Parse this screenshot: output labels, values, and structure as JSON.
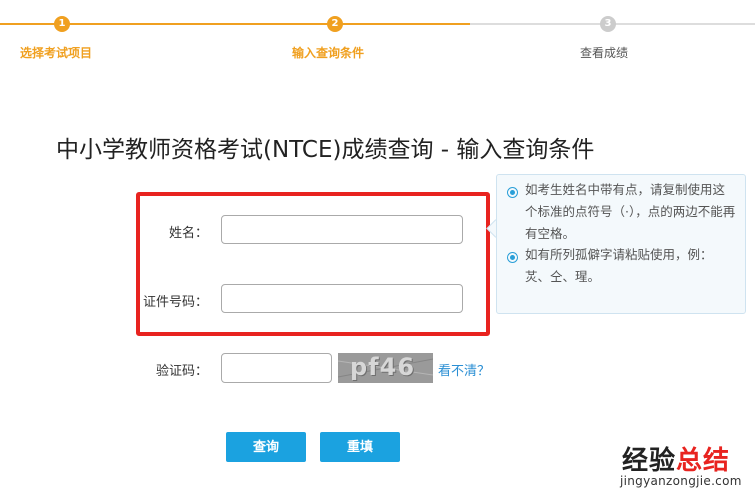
{
  "steps": [
    {
      "number": "1",
      "label": "选择考试项目"
    },
    {
      "number": "2",
      "label": "输入查询条件"
    },
    {
      "number": "3",
      "label": "查看成绩"
    }
  ],
  "page_title": "中小学教师资格考试(NTCE)成绩查询 - 输入查询条件",
  "form": {
    "name_label": "姓名：",
    "name_value": "",
    "id_label": "证件号码：",
    "id_value": "",
    "captcha_label": "验证码：",
    "captcha_value": "",
    "captcha_image_text": "pf46",
    "refresh_link": "看不清？"
  },
  "tips": [
    "如考生姓名中带有点，请复制使用这个标准的点符号（·），点的两边不能再有空格。",
    "如有所列孤僻字请粘贴使用，例：炗、仝、瑆。"
  ],
  "buttons": {
    "query": "查询",
    "reset": "重填"
  },
  "watermark": {
    "part1": "经验",
    "part2": "总结",
    "url": "jingyanzongjie.com"
  },
  "colors": {
    "step_active": "#f0a020",
    "step_inactive": "#cccccc",
    "button": "#1ba2e0",
    "highlight_border": "#e8231f",
    "link": "#2b8fd4",
    "tip_icon": "#2a9fd8"
  }
}
